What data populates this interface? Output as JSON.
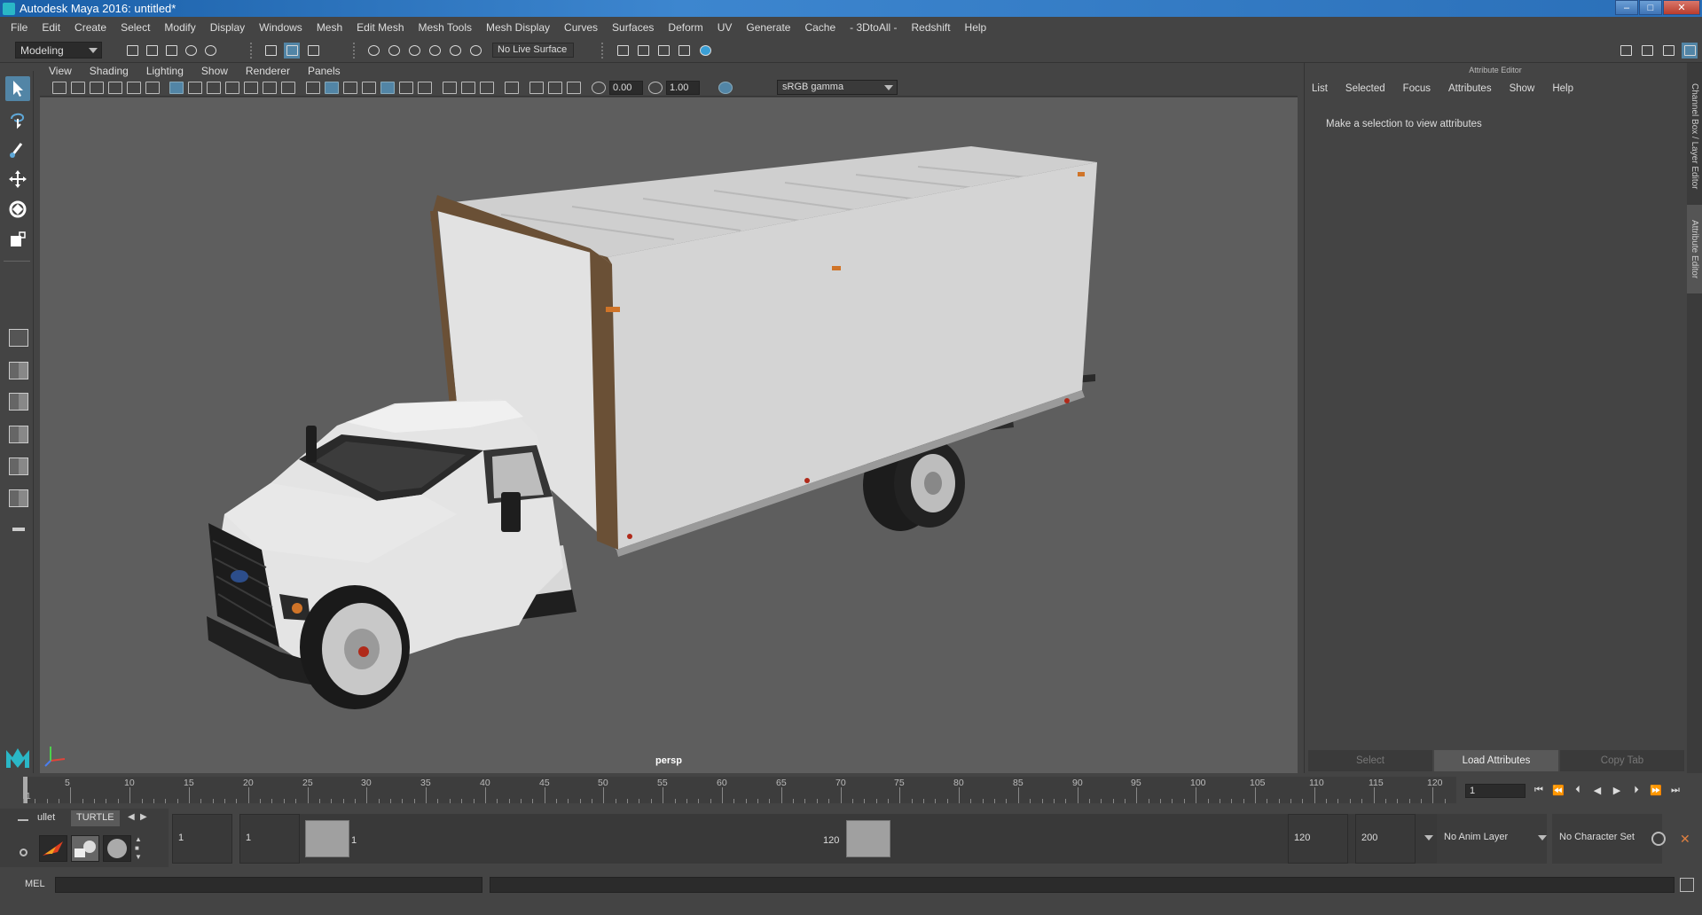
{
  "window": {
    "title": "Autodesk Maya 2016: untitled*",
    "buttons": [
      "–",
      "□",
      "✕"
    ]
  },
  "menubar": [
    "File",
    "Edit",
    "Create",
    "Select",
    "Modify",
    "Display",
    "Windows",
    "Mesh",
    "Edit Mesh",
    "Mesh Tools",
    "Mesh Display",
    "Curves",
    "Surfaces",
    "Deform",
    "UV",
    "Generate",
    "Cache",
    "- 3DtoAll -",
    "Redshift",
    "Help"
  ],
  "statusline": {
    "mode": "Modeling",
    "live_surface": "No Live Surface"
  },
  "viewport": {
    "menu": [
      "View",
      "Shading",
      "Lighting",
      "Show",
      "Renderer",
      "Panels"
    ],
    "exposure": "0.00",
    "gamma_value": "1.00",
    "color_space": "sRGB gamma",
    "camera_label": "persp",
    "colors": {
      "background": "#5e5e5e",
      "box_body": "#d6d6d6",
      "trim": "#6a5036",
      "cab": "#e3e3e3"
    }
  },
  "attribute_editor": {
    "title": "Attribute Editor",
    "menu": [
      "List",
      "Selected",
      "Focus",
      "Attributes",
      "Show",
      "Help"
    ],
    "hint": "Make a selection to view attributes",
    "buttons": {
      "select": "Select",
      "load": "Load Attributes",
      "copy": "Copy Tab"
    }
  },
  "side_tabs": {
    "channel_box": "Channel Box / Layer Editor",
    "attribute_editor": "Attribute Editor"
  },
  "timeline": {
    "ticks": [
      "5",
      "10",
      "15",
      "20",
      "25",
      "30",
      "35",
      "40",
      "45",
      "50",
      "55",
      "60",
      "65",
      "70",
      "75",
      "80",
      "85",
      "90",
      "95",
      "100",
      "105",
      "110",
      "115",
      "120"
    ],
    "first_frame": "1",
    "current_frame": "1",
    "playback_buttons": [
      "⏮",
      "⏪",
      "⏴",
      "◀",
      "▶",
      "⏵",
      "⏩",
      "⏭"
    ]
  },
  "shelf": {
    "tabs": [
      "ullet",
      "TURTLE"
    ]
  },
  "range": {
    "anim_start": "1",
    "playback_start": "1",
    "slider_start": "1",
    "slider_end": "120",
    "playback_end": "120",
    "anim_end": "200",
    "anim_layer": "No Anim Layer",
    "character_set": "No Character Set"
  },
  "command_line": {
    "label": "MEL"
  }
}
